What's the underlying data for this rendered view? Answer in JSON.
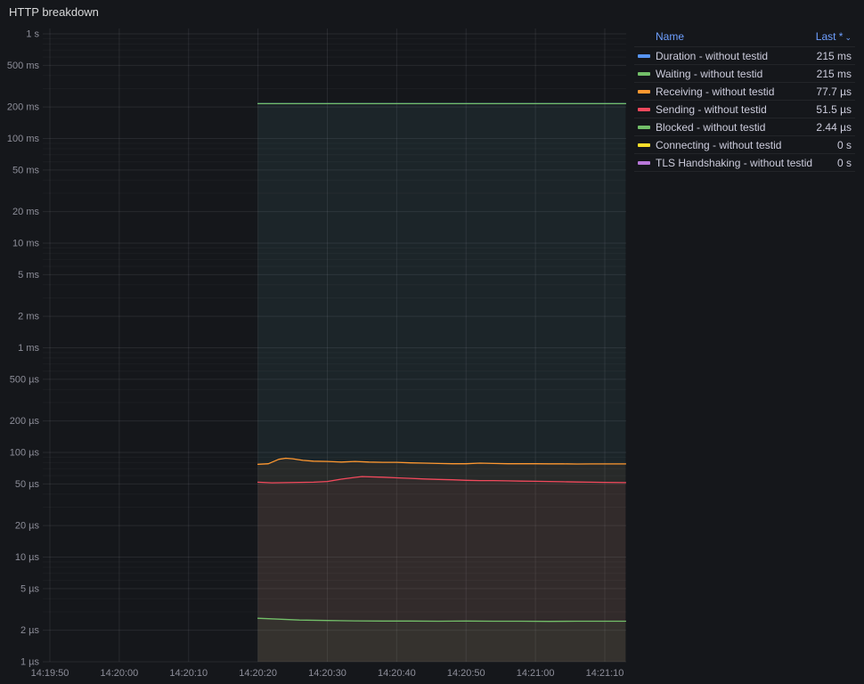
{
  "panel": {
    "title": "HTTP breakdown"
  },
  "legend": {
    "columns": [
      "Name",
      "Last *"
    ],
    "sort_caret": "⌄",
    "rows": [
      {
        "name": "Duration - without testid",
        "last": "215 ms",
        "color": "#5794F2"
      },
      {
        "name": "Waiting - without testid",
        "last": "215 ms",
        "color": "#73BF69"
      },
      {
        "name": "Receiving - without testid",
        "last": "77.7 µs",
        "color": "#FF9830"
      },
      {
        "name": "Sending - without testid",
        "last": "51.5 µs",
        "color": "#F2495C"
      },
      {
        "name": "Blocked - without testid",
        "last": "2.44 µs",
        "color": "#73BF69"
      },
      {
        "name": "Connecting - without testid",
        "last": "0 s",
        "color": "#FADE2A"
      },
      {
        "name": "TLS Handshaking - without testid",
        "last": "0 s",
        "color": "#B877D9"
      }
    ]
  },
  "chart_data": {
    "type": "line",
    "title": "HTTP breakdown",
    "y_scale": "log",
    "ylim_seconds": [
      1e-06,
      1
    ],
    "grid": true,
    "legend_position": "right-table",
    "x_ticks": [
      {
        "label": "14:19:50",
        "t": 0
      },
      {
        "label": "14:20:00",
        "t": 10
      },
      {
        "label": "14:20:10",
        "t": 20
      },
      {
        "label": "14:20:20",
        "t": 30
      },
      {
        "label": "14:20:30",
        "t": 40
      },
      {
        "label": "14:20:40",
        "t": 50
      },
      {
        "label": "14:20:50",
        "t": 60
      },
      {
        "label": "14:21:00",
        "t": 70
      },
      {
        "label": "14:21:10",
        "t": 80
      }
    ],
    "y_ticks": [
      {
        "label": "1 s",
        "v": 1
      },
      {
        "label": "500 ms",
        "v": 0.5
      },
      {
        "label": "200 ms",
        "v": 0.2
      },
      {
        "label": "100 ms",
        "v": 0.1
      },
      {
        "label": "50 ms",
        "v": 0.05
      },
      {
        "label": "20 ms",
        "v": 0.02
      },
      {
        "label": "10 ms",
        "v": 0.01
      },
      {
        "label": "5 ms",
        "v": 0.005
      },
      {
        "label": "2 ms",
        "v": 0.002
      },
      {
        "label": "1 ms",
        "v": 0.001
      },
      {
        "label": "500 µs",
        "v": 0.0005
      },
      {
        "label": "200 µs",
        "v": 0.0002
      },
      {
        "label": "100 µs",
        "v": 0.0001
      },
      {
        "label": "50 µs",
        "v": 5e-05
      },
      {
        "label": "20 µs",
        "v": 2e-05
      },
      {
        "label": "10 µs",
        "v": 1e-05
      },
      {
        "label": "5 µs",
        "v": 5e-06
      },
      {
        "label": "2 µs",
        "v": 2e-06
      },
      {
        "label": "1 µs",
        "v": 1e-06
      }
    ],
    "series": [
      {
        "name": "Duration - without testid",
        "color": "#5794F2",
        "last": "215 ms",
        "points": [
          [
            30,
            0.215
          ],
          [
            40,
            0.215
          ],
          [
            50,
            0.215
          ],
          [
            60,
            0.215
          ],
          [
            70,
            0.215
          ],
          [
            83,
            0.215
          ]
        ]
      },
      {
        "name": "Waiting - without testid",
        "color": "#73BF69",
        "last": "215 ms",
        "points": [
          [
            30,
            0.215
          ],
          [
            40,
            0.215
          ],
          [
            50,
            0.215
          ],
          [
            60,
            0.215
          ],
          [
            70,
            0.215
          ],
          [
            83,
            0.215
          ]
        ]
      },
      {
        "name": "Receiving - without testid",
        "color": "#FF9830",
        "last": "77.7 µs",
        "points": [
          [
            30,
            7.7e-05
          ],
          [
            31.5,
            7.8e-05
          ],
          [
            33,
            8.6e-05
          ],
          [
            34,
            8.8e-05
          ],
          [
            35,
            8.7e-05
          ],
          [
            36.5,
            8.4e-05
          ],
          [
            38,
            8.25e-05
          ],
          [
            40,
            8.2e-05
          ],
          [
            42,
            8.1e-05
          ],
          [
            44,
            8.2e-05
          ],
          [
            46,
            8.1e-05
          ],
          [
            48,
            8.05e-05
          ],
          [
            50,
            8.05e-05
          ],
          [
            52,
            7.95e-05
          ],
          [
            54,
            7.9e-05
          ],
          [
            56,
            7.85e-05
          ],
          [
            58,
            7.8e-05
          ],
          [
            60,
            7.8e-05
          ],
          [
            62,
            7.9e-05
          ],
          [
            64,
            7.85e-05
          ],
          [
            66,
            7.8e-05
          ],
          [
            68,
            7.8e-05
          ],
          [
            70,
            7.8e-05
          ],
          [
            72,
            7.78e-05
          ],
          [
            74,
            7.78e-05
          ],
          [
            76,
            7.75e-05
          ],
          [
            78,
            7.77e-05
          ],
          [
            80,
            7.77e-05
          ],
          [
            83,
            7.77e-05
          ]
        ]
      },
      {
        "name": "Sending - without testid",
        "color": "#F2495C",
        "last": "51.5 µs",
        "points": [
          [
            30,
            5.2e-05
          ],
          [
            32,
            5.13e-05
          ],
          [
            34,
            5.15e-05
          ],
          [
            36,
            5.18e-05
          ],
          [
            38,
            5.2e-05
          ],
          [
            40,
            5.28e-05
          ],
          [
            42,
            5.55e-05
          ],
          [
            44,
            5.78e-05
          ],
          [
            45,
            5.88e-05
          ],
          [
            46,
            5.85e-05
          ],
          [
            48,
            5.8e-05
          ],
          [
            50,
            5.72e-05
          ],
          [
            52,
            5.65e-05
          ],
          [
            54,
            5.58e-05
          ],
          [
            56,
            5.52e-05
          ],
          [
            58,
            5.48e-05
          ],
          [
            60,
            5.42e-05
          ],
          [
            62,
            5.38e-05
          ],
          [
            64,
            5.38e-05
          ],
          [
            66,
            5.35e-05
          ],
          [
            68,
            5.32e-05
          ],
          [
            70,
            5.3e-05
          ],
          [
            72,
            5.28e-05
          ],
          [
            74,
            5.25e-05
          ],
          [
            76,
            5.22e-05
          ],
          [
            78,
            5.2e-05
          ],
          [
            80,
            5.18e-05
          ],
          [
            83,
            5.15e-05
          ]
        ]
      },
      {
        "name": "Blocked - without testid",
        "color": "#73BF69",
        "last": "2.44 µs",
        "points": [
          [
            30,
            2.6e-06
          ],
          [
            33,
            2.55e-06
          ],
          [
            36,
            2.5e-06
          ],
          [
            40,
            2.48e-06
          ],
          [
            44,
            2.46e-06
          ],
          [
            48,
            2.45e-06
          ],
          [
            52,
            2.45e-06
          ],
          [
            56,
            2.44e-06
          ],
          [
            60,
            2.45e-06
          ],
          [
            64,
            2.44e-06
          ],
          [
            68,
            2.44e-06
          ],
          [
            72,
            2.43e-06
          ],
          [
            76,
            2.44e-06
          ],
          [
            80,
            2.44e-06
          ],
          [
            83,
            2.44e-06
          ]
        ]
      },
      {
        "name": "Connecting - without testid",
        "color": "#FADE2A",
        "last": "0 s",
        "points": []
      },
      {
        "name": "TLS Handshaking - without testid",
        "color": "#B877D9",
        "last": "0 s",
        "points": []
      }
    ]
  }
}
